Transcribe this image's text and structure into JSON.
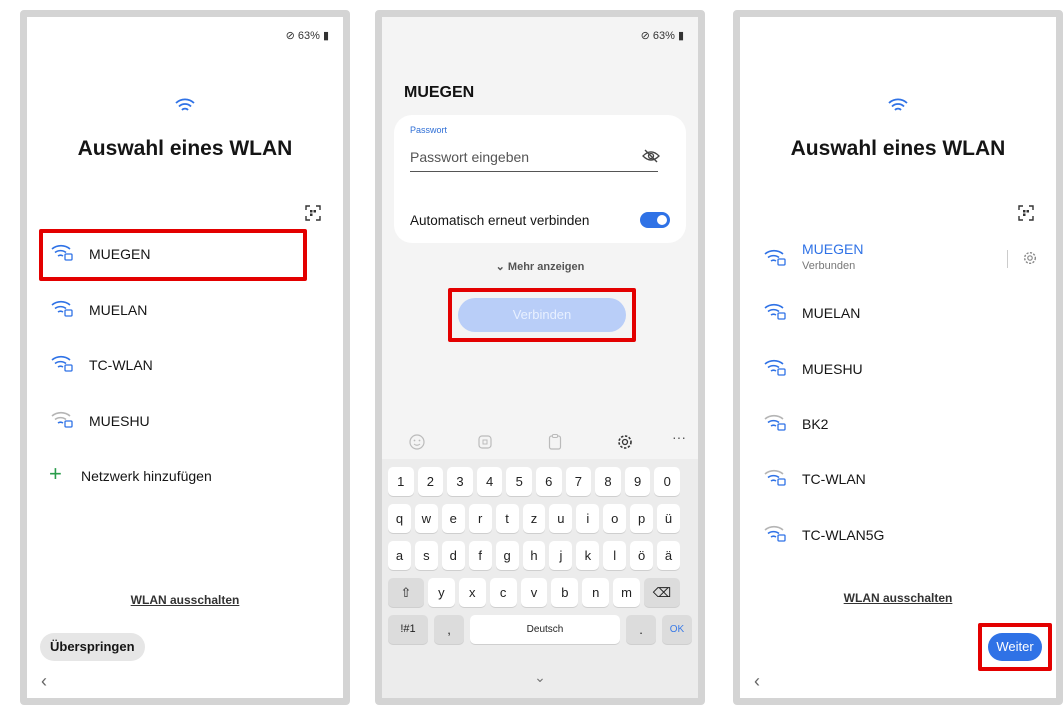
{
  "status": {
    "battery": "63%",
    "dnd_glyph": "⊘"
  },
  "screen1": {
    "title": "Auswahl eines WLAN",
    "networks": [
      {
        "name": "MUEGEN",
        "dim": false
      },
      {
        "name": "MUELAN",
        "dim": false
      },
      {
        "name": "TC-WLAN",
        "dim": false
      },
      {
        "name": "MUESHU",
        "dim": true
      }
    ],
    "add_network": "Netzwerk hinzufügen",
    "wifi_off": "WLAN ausschalten",
    "skip": "Überspringen",
    "back_glyph": "‹"
  },
  "screen2": {
    "network_name": "MUEGEN",
    "password_label": "Passwort",
    "password_placeholder": "Passwort eingeben",
    "auto_reconnect": "Automatisch erneut verbinden",
    "auto_reconnect_on": true,
    "more": "⌄  Mehr anzeigen",
    "connect": "Verbinden",
    "keyboard": {
      "row1": [
        "1",
        "2",
        "3",
        "4",
        "5",
        "6",
        "7",
        "8",
        "9",
        "0"
      ],
      "row2": [
        "q",
        "w",
        "e",
        "r",
        "t",
        "z",
        "u",
        "i",
        "o",
        "p",
        "ü"
      ],
      "row3": [
        "a",
        "s",
        "d",
        "f",
        "g",
        "h",
        "j",
        "k",
        "l",
        "ö",
        "ä"
      ],
      "row4": [
        "⇧",
        "y",
        "x",
        "c",
        "v",
        "b",
        "n",
        "m",
        "⌫"
      ],
      "sym": "!#1",
      "comma": ",",
      "space": "Deutsch",
      "period": ".",
      "ok": "OK",
      "hide": "⌄"
    },
    "toolbar_more": "···"
  },
  "screen3": {
    "title": "Auswahl eines WLAN",
    "connected_network": "MUEGEN",
    "connected_status": "Verbunden",
    "networks": [
      "MUELAN",
      "MUESHU",
      "BK2",
      "TC-WLAN",
      "TC-WLAN5G"
    ],
    "wifi_off": "WLAN ausschalten",
    "next": "Weiter",
    "back_glyph": "‹"
  },
  "colors": {
    "accent": "#2f72e6",
    "highlight": "#e30000",
    "connect_disabled": "#b9cef8"
  }
}
